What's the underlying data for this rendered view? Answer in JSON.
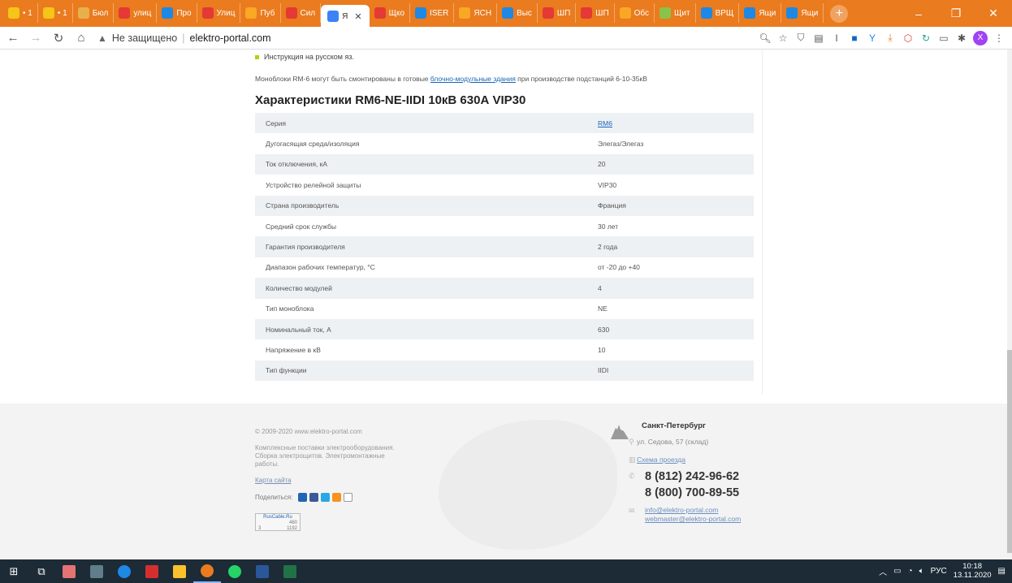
{
  "browser": {
    "tabs": [
      {
        "label": "• 1",
        "color": "#f5c518"
      },
      {
        "label": "• 1",
        "color": "#f5c518"
      },
      {
        "label": "Бюл",
        "color": "#e8b04c"
      },
      {
        "label": "улиц",
        "color": "#e53935"
      },
      {
        "label": "Про",
        "color": "#1e88e5"
      },
      {
        "label": "Улиц",
        "color": "#e53935"
      },
      {
        "label": "Пуб",
        "color": "#f9a825"
      },
      {
        "label": "Сил",
        "color": "#e53935"
      },
      {
        "label": "Я",
        "color": "#3b82f6",
        "active": true
      },
      {
        "label": "Щко",
        "color": "#e53935"
      },
      {
        "label": "ISER",
        "color": "#1e88e5"
      },
      {
        "label": "ЯСН",
        "color": "#f9a825"
      },
      {
        "label": "Выс",
        "color": "#1e88e5"
      },
      {
        "label": "ШП",
        "color": "#e53935"
      },
      {
        "label": "ШП",
        "color": "#e53935"
      },
      {
        "label": "Обс",
        "color": "#f9a825"
      },
      {
        "label": "Щит",
        "color": "#8bc34a"
      },
      {
        "label": "ВРЩ",
        "color": "#1e88e5"
      },
      {
        "label": "Ящи",
        "color": "#1e88e5"
      },
      {
        "label": "Ящи",
        "color": "#1e88e5"
      }
    ],
    "accent": "#ea7b1e",
    "address": {
      "security": "Не защищено",
      "domain": "elektro-portal.com"
    }
  },
  "page": {
    "bullet": "Инструкция на русском яз.",
    "intro_before": "Моноблоки RM-6 могут быть смонтированы в готовые ",
    "intro_link": "блочно-модульные здания",
    "intro_after": " при производстве подстанций 6-10-35кВ",
    "spec_title": "Характеристики RM6-NE-IIDI 10кВ 630А VIP30",
    "specs": [
      {
        "name": "Серия",
        "value": "RM6",
        "link": true
      },
      {
        "name": "Дугогасящая среда/изоляция",
        "value": "Элегаз/Элегаз"
      },
      {
        "name": "Ток отключения, кА",
        "value": "20"
      },
      {
        "name": "Устройство релейной защиты",
        "value": "VIP30"
      },
      {
        "name": "Страна производитель",
        "value": "Франция"
      },
      {
        "name": "Средний срок службы",
        "value": "30 лет"
      },
      {
        "name": "Гарантия производителя",
        "value": "2 года"
      },
      {
        "name": "Диапазон рабочих температур, °С",
        "value": "от -20 до +40"
      },
      {
        "name": "Количество модулей",
        "value": "4"
      },
      {
        "name": "Тип моноблока",
        "value": "NE"
      },
      {
        "name": "Номинальный ток, А",
        "value": "630"
      },
      {
        "name": "Напряжение в кВ",
        "value": "10"
      },
      {
        "name": "Тип функции",
        "value": "IIDI"
      }
    ]
  },
  "footer": {
    "copyright": "© 2009-2020 www.elektro-portal.com",
    "description": "Комплексные поставки электрооборудования. Сборка электрощитов. Электромонтажные работы.",
    "sitemap": "Карта сайта",
    "share_label": "Поделиться:",
    "counter": {
      "title": "RusCable.Ru",
      "a": "460",
      "b": "1192",
      "c": "3"
    },
    "city": "Санкт-Петербург",
    "address": "ул. Седова, 57 (склад)",
    "route": "Схема проезда",
    "phone1": "8 (812) 242-96-62",
    "phone2": "8 (800) 700-89-55",
    "email1": "info@elektro-portal.com",
    "email2": "webmaster@elektro-portal.com"
  },
  "taskbar": {
    "language": "РУС",
    "time": "10:18",
    "date": "13.11.2020"
  }
}
